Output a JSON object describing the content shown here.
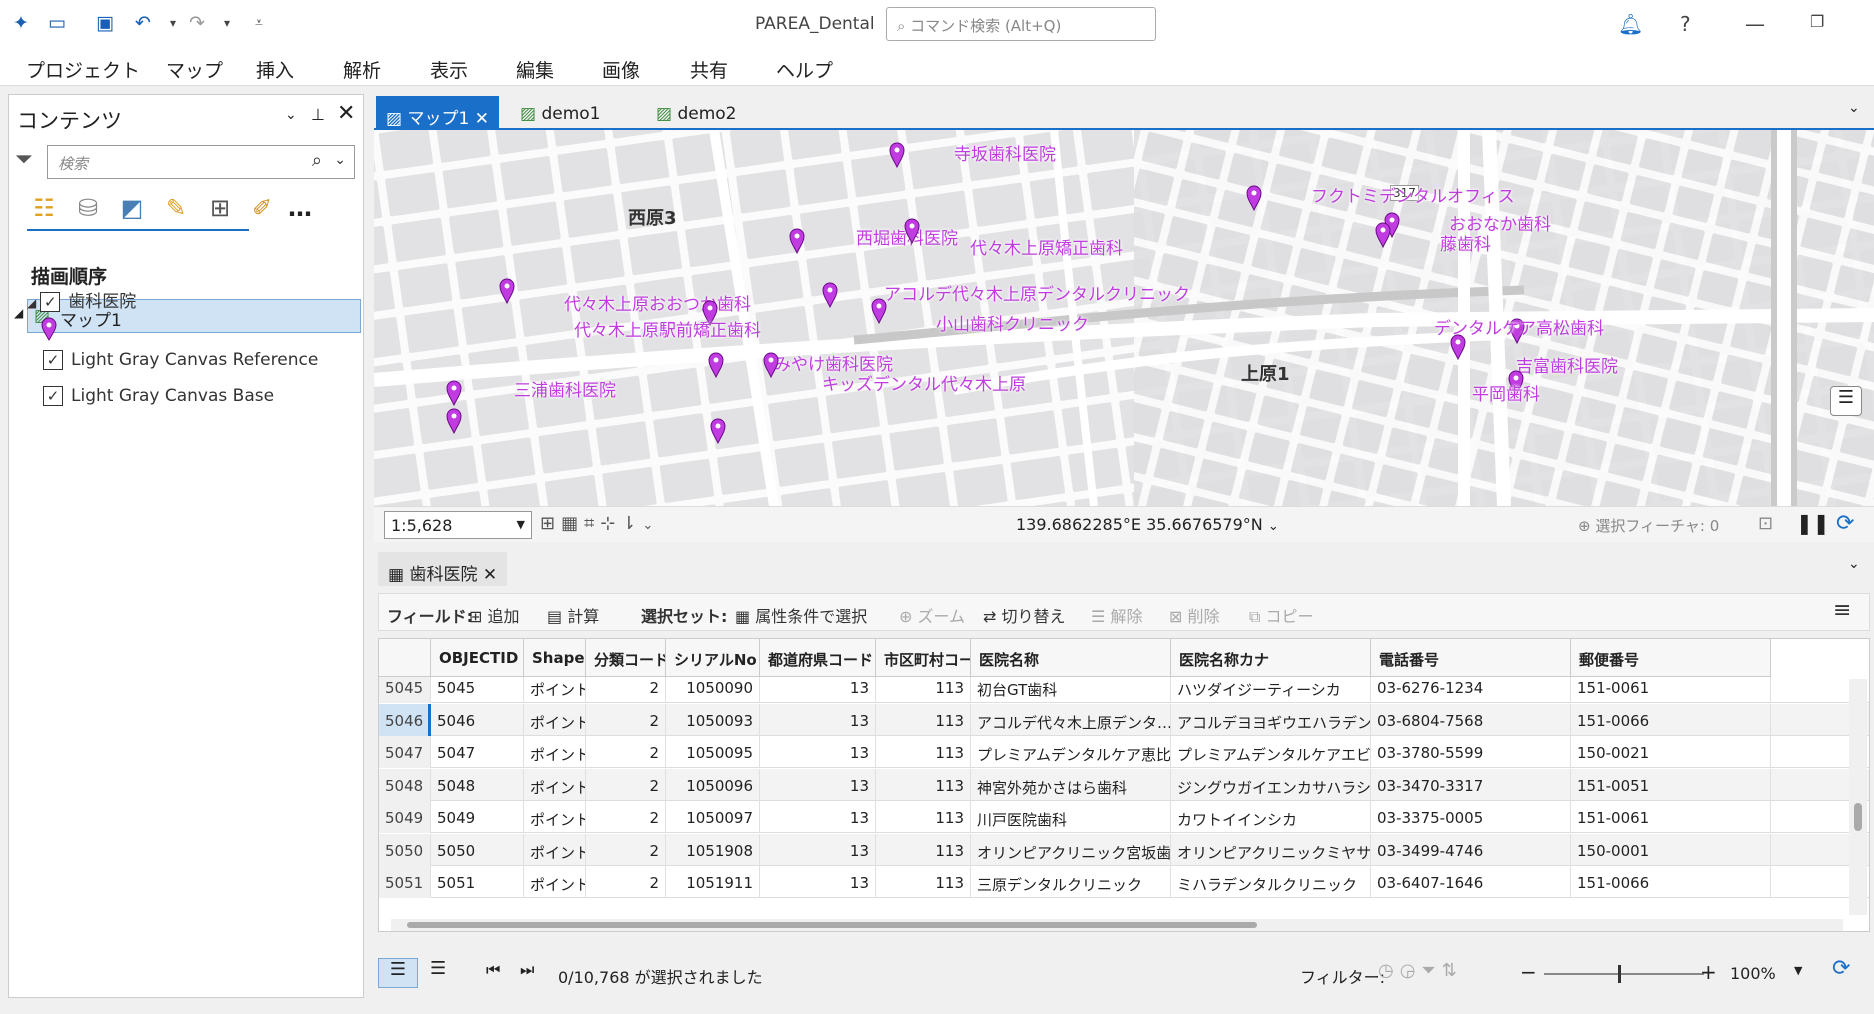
{
  "app": {
    "title": "PAREA_Dental",
    "search_placeholder": "コマンド検索 (Alt+Q)"
  },
  "menu": [
    "プロジェクト",
    "マップ",
    "挿入",
    "解析",
    "表示",
    "編集",
    "画像",
    "共有",
    "ヘルプ"
  ],
  "contents": {
    "title": "コンテンツ",
    "search_placeholder": "検索",
    "draw_order": "描画順序",
    "layers": {
      "map": "マップ1",
      "dental": "歯科医院",
      "ref": "Light Gray Canvas Reference",
      "base": "Light Gray Canvas Base"
    }
  },
  "map_tabs": [
    "マップ1",
    "demo1",
    "demo2"
  ],
  "map": {
    "areas": [
      {
        "label": "西原3"
      },
      {
        "label": "上原1"
      }
    ],
    "pois": [
      {
        "label": "寺坂歯科医院"
      },
      {
        "label": "フクトミデンタルオフィス"
      },
      {
        "label": "おおなか歯科"
      },
      {
        "label": "藤歯科"
      },
      {
        "label": "西堀歯科医院"
      },
      {
        "label": "代々木上原矯正歯科"
      },
      {
        "label": "アコルデ代々木上原デンタルクリニック"
      },
      {
        "label": "代々木上原おおつか歯科"
      },
      {
        "label": "小山歯科クリニック"
      },
      {
        "label": "代々木上原駅前矯正歯科"
      },
      {
        "label": "デンタルケア高松歯科"
      },
      {
        "label": "みやけ歯科医院"
      },
      {
        "label": "キッズデンタル代々木上原"
      },
      {
        "label": "吉富歯科医院"
      },
      {
        "label": "三浦歯科医院"
      },
      {
        "label": "平岡歯科"
      }
    ],
    "road_label": "317",
    "scale": "1:5,628",
    "coords": "139.6862285°E 35.6676579°N",
    "selected": "選択フィーチャ: 0"
  },
  "table": {
    "tab": "歯科医院",
    "toolbar": {
      "field": "フィールド:",
      "add": "追加",
      "calc": "計算",
      "selset": "選択セット:",
      "attr": "属性条件で選択",
      "zoom": "ズーム",
      "switch": "切り替え",
      "clear": "解除",
      "delete": "削除",
      "copy": "コピー"
    },
    "columns": [
      "OBJECTID *",
      "Shape *",
      "分類コード",
      "シリアルNo",
      "都道府県コード",
      "市区町村コード",
      "医院名称",
      "医院名称カナ",
      "電話番号",
      "郵便番号"
    ],
    "rows": [
      [
        "5045",
        "5045",
        "ポイント",
        "2",
        "1050090",
        "13",
        "113",
        "初台GT歯科",
        "ハツダイジーティーシカ",
        "03-6276-1234",
        "151-0061"
      ],
      [
        "5046",
        "5046",
        "ポイント",
        "2",
        "1050093",
        "13",
        "113",
        "アコルデ代々木上原デンタ…",
        "アコルデヨヨギウエハラデン…",
        "03-6804-7568",
        "151-0066"
      ],
      [
        "5047",
        "5047",
        "ポイント",
        "2",
        "1050095",
        "13",
        "113",
        "プレミアムデンタルケア恵比…",
        "プレミアムデンタルケアエビス…",
        "03-3780-5599",
        "150-0021"
      ],
      [
        "5048",
        "5048",
        "ポイント",
        "2",
        "1050096",
        "13",
        "113",
        "神宮外苑かさはら歯科",
        "ジングウガイエンカサハラシカ",
        "03-3470-3317",
        "151-0051"
      ],
      [
        "5049",
        "5049",
        "ポイント",
        "2",
        "1050097",
        "13",
        "113",
        "川戸医院歯科",
        "カワトイインシカ",
        "03-3375-0005",
        "151-0061"
      ],
      [
        "5050",
        "5050",
        "ポイント",
        "2",
        "1051908",
        "13",
        "113",
        "オリンピアクリニック宮坂歯…",
        "オリンピアクリニックミヤサカ…",
        "03-3499-4746",
        "150-0001"
      ],
      [
        "5051",
        "5051",
        "ポイント",
        "2",
        "1051911",
        "13",
        "113",
        "三原デンタルクリニック",
        "ミハラデンタルクリニック",
        "03-6407-1646",
        "151-0066"
      ]
    ],
    "status": "0/10,768 が選択されました",
    "filter": "フィルター:",
    "zoom": "100%"
  },
  "colors": {
    "poi": "#c03ce0",
    "accent": "#1a6fc9"
  }
}
